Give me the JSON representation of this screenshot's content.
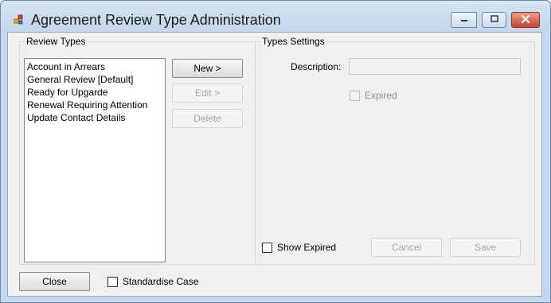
{
  "window": {
    "title": "Agreement Review Type Administration"
  },
  "review_types_group": {
    "legend": "Review Types",
    "items": [
      "Account in Arrears",
      "General Review [Default]",
      "Ready for Upgarde",
      "Renewal Requiring Attention",
      "Update Contact Details"
    ],
    "new_label": "New >",
    "edit_label": "Edit >",
    "delete_label": "Delete"
  },
  "types_settings_group": {
    "legend": "Types Settings",
    "description_label": "Description:",
    "description_value": "",
    "expired_label": "Expired",
    "expired_checked": false,
    "show_expired_label": "Show Expired",
    "show_expired_checked": false,
    "cancel_label": "Cancel",
    "save_label": "Save"
  },
  "footer": {
    "close_label": "Close",
    "standardise_case_label": "Standardise Case",
    "standardise_case_checked": false
  }
}
